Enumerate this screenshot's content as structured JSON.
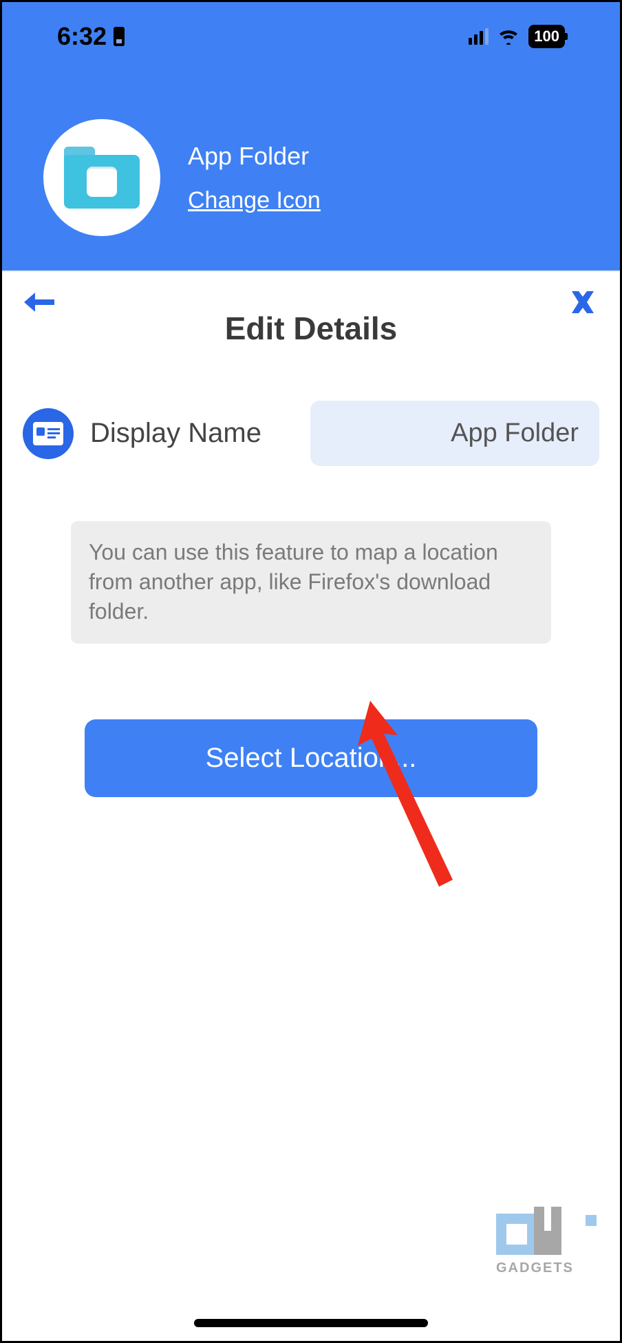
{
  "status": {
    "time": "6:32",
    "battery": "100"
  },
  "header": {
    "title": "App Folder",
    "change_icon": "Change Icon"
  },
  "page": {
    "title": "Edit Details"
  },
  "form": {
    "display_name_label": "Display Name",
    "display_name_value": "App Folder",
    "info_text": "You can use this feature to map a location from another app, like Firefox's download folder.",
    "select_location_btn": "Select Location..."
  },
  "watermark": "GADGETS"
}
